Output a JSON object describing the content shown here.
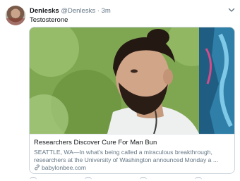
{
  "tweet": {
    "display_name": "Denlesks",
    "handle": "@Denlesks",
    "separator": "·",
    "time": "3m",
    "text": "Testosterone",
    "avatar_icon": "profile-photo-avatar",
    "menu_icon": "chevron-down-icon"
  },
  "card": {
    "title": "Researchers Discover Cure For Man Bun",
    "description": "SEATTLE, WA—In what's being called a miraculous breakthrough, researchers at the University of Washington announced Monday a ...",
    "domain": "babylonbee.com",
    "domain_icon": "link-icon"
  },
  "colors": {
    "text_primary": "#14171a",
    "text_secondary": "#657786",
    "border": "#ccd6dd"
  }
}
